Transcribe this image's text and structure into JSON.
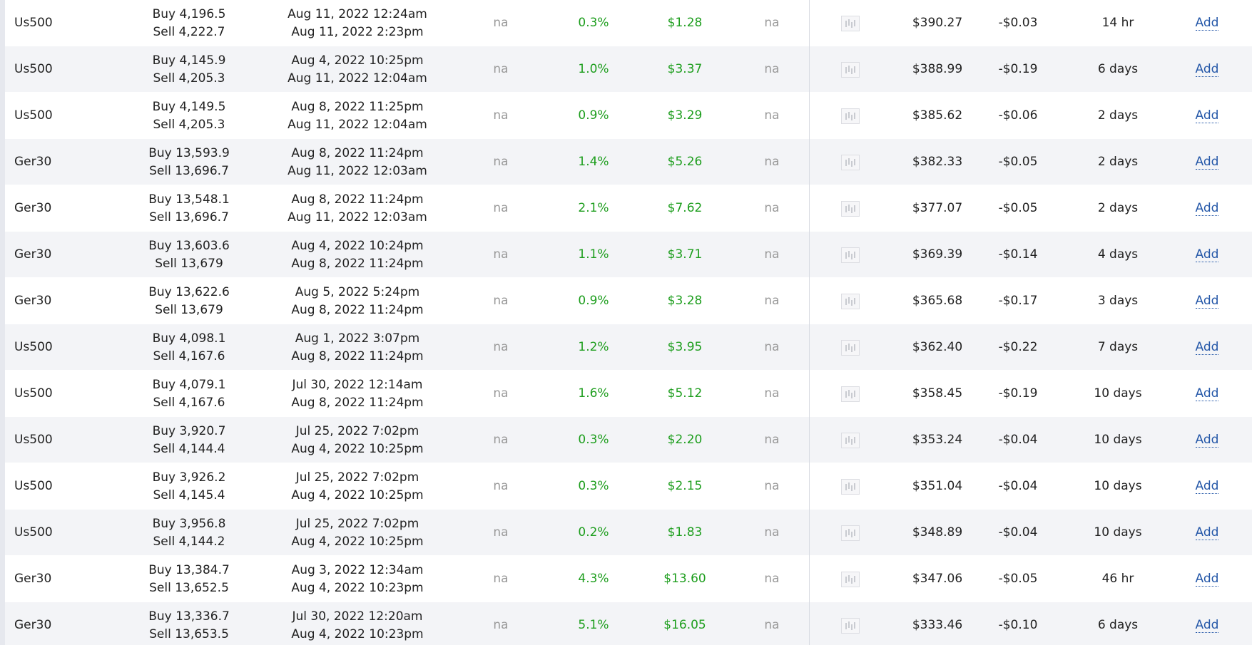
{
  "add_label": "Add",
  "na_label": "na",
  "rows": [
    {
      "symbol": "Us500",
      "buy": "Buy 4,196.5",
      "sell": "Sell 4,222.7",
      "open": "Aug 11, 2022 12:24am",
      "close": "Aug 11, 2022 2:23pm",
      "pct": "0.3%",
      "gain": "$1.28",
      "balance": "$390.27",
      "fee": "-$0.03",
      "duration": "14 hr"
    },
    {
      "symbol": "Us500",
      "buy": "Buy 4,145.9",
      "sell": "Sell 4,205.3",
      "open": "Aug 4, 2022 10:25pm",
      "close": "Aug 11, 2022 12:04am",
      "pct": "1.0%",
      "gain": "$3.37",
      "balance": "$388.99",
      "fee": "-$0.19",
      "duration": "6 days"
    },
    {
      "symbol": "Us500",
      "buy": "Buy 4,149.5",
      "sell": "Sell 4,205.3",
      "open": "Aug 8, 2022 11:25pm",
      "close": "Aug 11, 2022 12:04am",
      "pct": "0.9%",
      "gain": "$3.29",
      "balance": "$385.62",
      "fee": "-$0.06",
      "duration": "2 days"
    },
    {
      "symbol": "Ger30",
      "buy": "Buy 13,593.9",
      "sell": "Sell 13,696.7",
      "open": "Aug 8, 2022 11:24pm",
      "close": "Aug 11, 2022 12:03am",
      "pct": "1.4%",
      "gain": "$5.26",
      "balance": "$382.33",
      "fee": "-$0.05",
      "duration": "2 days"
    },
    {
      "symbol": "Ger30",
      "buy": "Buy 13,548.1",
      "sell": "Sell 13,696.7",
      "open": "Aug 8, 2022 11:24pm",
      "close": "Aug 11, 2022 12:03am",
      "pct": "2.1%",
      "gain": "$7.62",
      "balance": "$377.07",
      "fee": "-$0.05",
      "duration": "2 days"
    },
    {
      "symbol": "Ger30",
      "buy": "Buy 13,603.6",
      "sell": "Sell 13,679",
      "open": "Aug 4, 2022 10:24pm",
      "close": "Aug 8, 2022 11:24pm",
      "pct": "1.1%",
      "gain": "$3.71",
      "balance": "$369.39",
      "fee": "-$0.14",
      "duration": "4 days"
    },
    {
      "symbol": "Ger30",
      "buy": "Buy 13,622.6",
      "sell": "Sell 13,679",
      "open": "Aug 5, 2022 5:24pm",
      "close": "Aug 8, 2022 11:24pm",
      "pct": "0.9%",
      "gain": "$3.28",
      "balance": "$365.68",
      "fee": "-$0.17",
      "duration": "3 days"
    },
    {
      "symbol": "Us500",
      "buy": "Buy 4,098.1",
      "sell": "Sell 4,167.6",
      "open": "Aug 1, 2022 3:07pm",
      "close": "Aug 8, 2022 11:24pm",
      "pct": "1.2%",
      "gain": "$3.95",
      "balance": "$362.40",
      "fee": "-$0.22",
      "duration": "7 days"
    },
    {
      "symbol": "Us500",
      "buy": "Buy 4,079.1",
      "sell": "Sell 4,167.6",
      "open": "Jul 30, 2022 12:14am",
      "close": "Aug 8, 2022 11:24pm",
      "pct": "1.6%",
      "gain": "$5.12",
      "balance": "$358.45",
      "fee": "-$0.19",
      "duration": "10 days"
    },
    {
      "symbol": "Us500",
      "buy": "Buy 3,920.7",
      "sell": "Sell 4,144.4",
      "open": "Jul 25, 2022 7:02pm",
      "close": "Aug 4, 2022 10:25pm",
      "pct": "0.3%",
      "gain": "$2.20",
      "balance": "$353.24",
      "fee": "-$0.04",
      "duration": "10 days"
    },
    {
      "symbol": "Us500",
      "buy": "Buy 3,926.2",
      "sell": "Sell 4,145.4",
      "open": "Jul 25, 2022 7:02pm",
      "close": "Aug 4, 2022 10:25pm",
      "pct": "0.3%",
      "gain": "$2.15",
      "balance": "$351.04",
      "fee": "-$0.04",
      "duration": "10 days"
    },
    {
      "symbol": "Us500",
      "buy": "Buy 3,956.8",
      "sell": "Sell 4,144.2",
      "open": "Jul 25, 2022 7:02pm",
      "close": "Aug 4, 2022 10:25pm",
      "pct": "0.2%",
      "gain": "$1.83",
      "balance": "$348.89",
      "fee": "-$0.04",
      "duration": "10 days"
    },
    {
      "symbol": "Ger30",
      "buy": "Buy 13,384.7",
      "sell": "Sell 13,652.5",
      "open": "Aug 3, 2022 12:34am",
      "close": "Aug 4, 2022 10:23pm",
      "pct": "4.3%",
      "gain": "$13.60",
      "balance": "$347.06",
      "fee": "-$0.05",
      "duration": "46 hr"
    },
    {
      "symbol": "Ger30",
      "buy": "Buy 13,336.7",
      "sell": "Sell 13,653.5",
      "open": "Jul 30, 2022 12:20am",
      "close": "Aug 4, 2022 10:23pm",
      "pct": "5.1%",
      "gain": "$16.05",
      "balance": "$333.46",
      "fee": "-$0.10",
      "duration": "6 days"
    }
  ]
}
